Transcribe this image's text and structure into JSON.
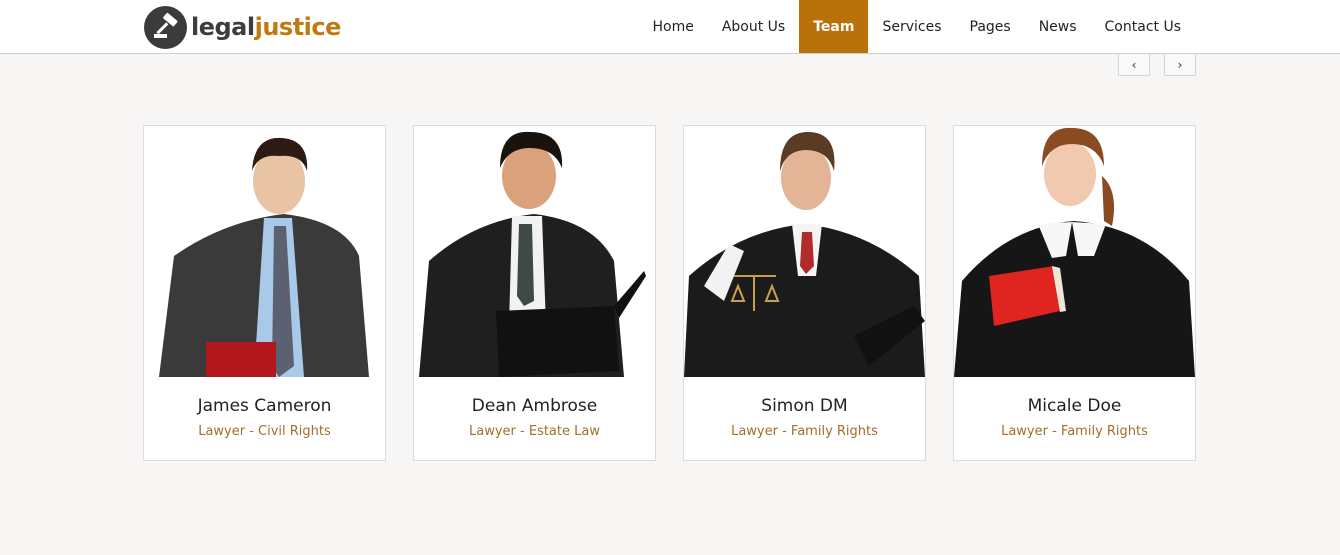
{
  "brand": {
    "part1": "legal",
    "part2": "justice",
    "icon": "gavel-icon"
  },
  "nav": {
    "items": [
      {
        "label": "Home",
        "active": false
      },
      {
        "label": "About Us",
        "active": false
      },
      {
        "label": "Team",
        "active": true
      },
      {
        "label": "Services",
        "active": false
      },
      {
        "label": "Pages",
        "active": false
      },
      {
        "label": "News",
        "active": false
      },
      {
        "label": "Contact Us",
        "active": false
      }
    ]
  },
  "carousel": {
    "prev_icon": "chevron-left-icon",
    "next_icon": "chevron-right-icon",
    "prev_glyph": "‹",
    "next_glyph": "›"
  },
  "team": [
    {
      "name": "James Cameron",
      "role": "Lawyer - Civil Rights"
    },
    {
      "name": "Dean Ambrose",
      "role": "Lawyer - Estate Law"
    },
    {
      "name": "Simon DM",
      "role": "Lawyer - Family Rights"
    },
    {
      "name": "Micale Doe",
      "role": "Lawyer - Family Rights"
    }
  ],
  "colors": {
    "accent": "#b8710b",
    "role_text": "#a26e2c",
    "page_bg": "#f8f5f5"
  }
}
